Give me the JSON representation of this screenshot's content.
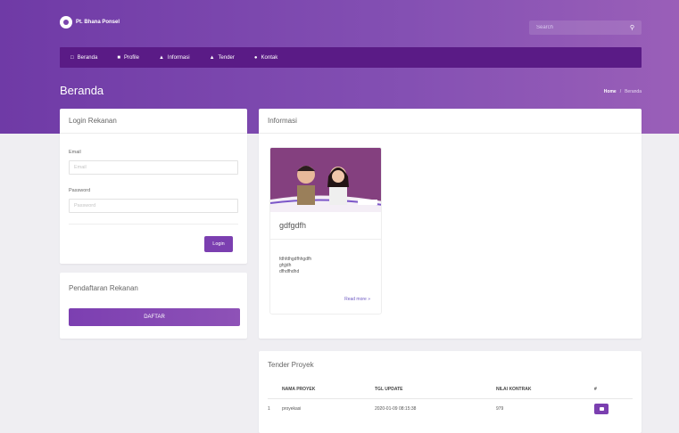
{
  "header": {
    "logo_text": "Pt. Bhana Ponsel",
    "search_placeholder": "Search"
  },
  "nav": {
    "items": [
      {
        "label": "Beranda",
        "icon": "monitor-icon"
      },
      {
        "label": "Profile",
        "icon": "truck-icon"
      },
      {
        "label": "Informasi",
        "icon": "car-icon"
      },
      {
        "label": "Tender",
        "icon": "car-icon"
      },
      {
        "label": "Kontak",
        "icon": "user-icon"
      }
    ]
  },
  "page": {
    "title": "Beranda",
    "breadcrumb_home": "Home",
    "breadcrumb_current": "Beranda"
  },
  "login": {
    "title": "Login Rekanan",
    "email_label": "Email",
    "email_placeholder": "Email",
    "password_label": "Password",
    "password_placeholder": "Password",
    "button": "Login"
  },
  "register": {
    "title": "Pendaftaran Rekanan",
    "button": "DAFTAR"
  },
  "info": {
    "title": "Informasi",
    "post": {
      "title": "gdfgdfh",
      "desc_lines": [
        "fdhfdhgdfhhgdfh",
        "ghjjdh",
        "dfhdfhdhd"
      ],
      "more": "Read more »"
    }
  },
  "tender": {
    "title": "Tender Proyek",
    "columns": [
      "NAMA PROYEK",
      "TGL UPDATE",
      "NILAI KONTRAK",
      "#"
    ],
    "rows": [
      {
        "no": "1",
        "name": "proyekasi",
        "date": "2020-01-09 08:15:38",
        "value": "979"
      }
    ]
  },
  "colors": {
    "brand": "#7b3fb0",
    "navbar": "#5a1b86"
  }
}
